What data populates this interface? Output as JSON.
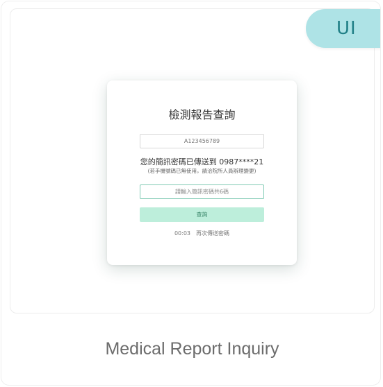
{
  "badge": {
    "label": "UI"
  },
  "modal": {
    "title": "檢測報告查詢",
    "id_number": "A123456789",
    "sms_message": "您的簡訊密碼已傳送到 0987****21",
    "sms_note": "(若手機號碼已無使用，請洽院所人員辦理變更)",
    "code_placeholder": "請輸入簡訊密碼共6碼",
    "submit_label": "查詢",
    "countdown": "00:03",
    "resend_label": "再次傳送密碼"
  },
  "caption": "Medical Report Inquiry"
}
